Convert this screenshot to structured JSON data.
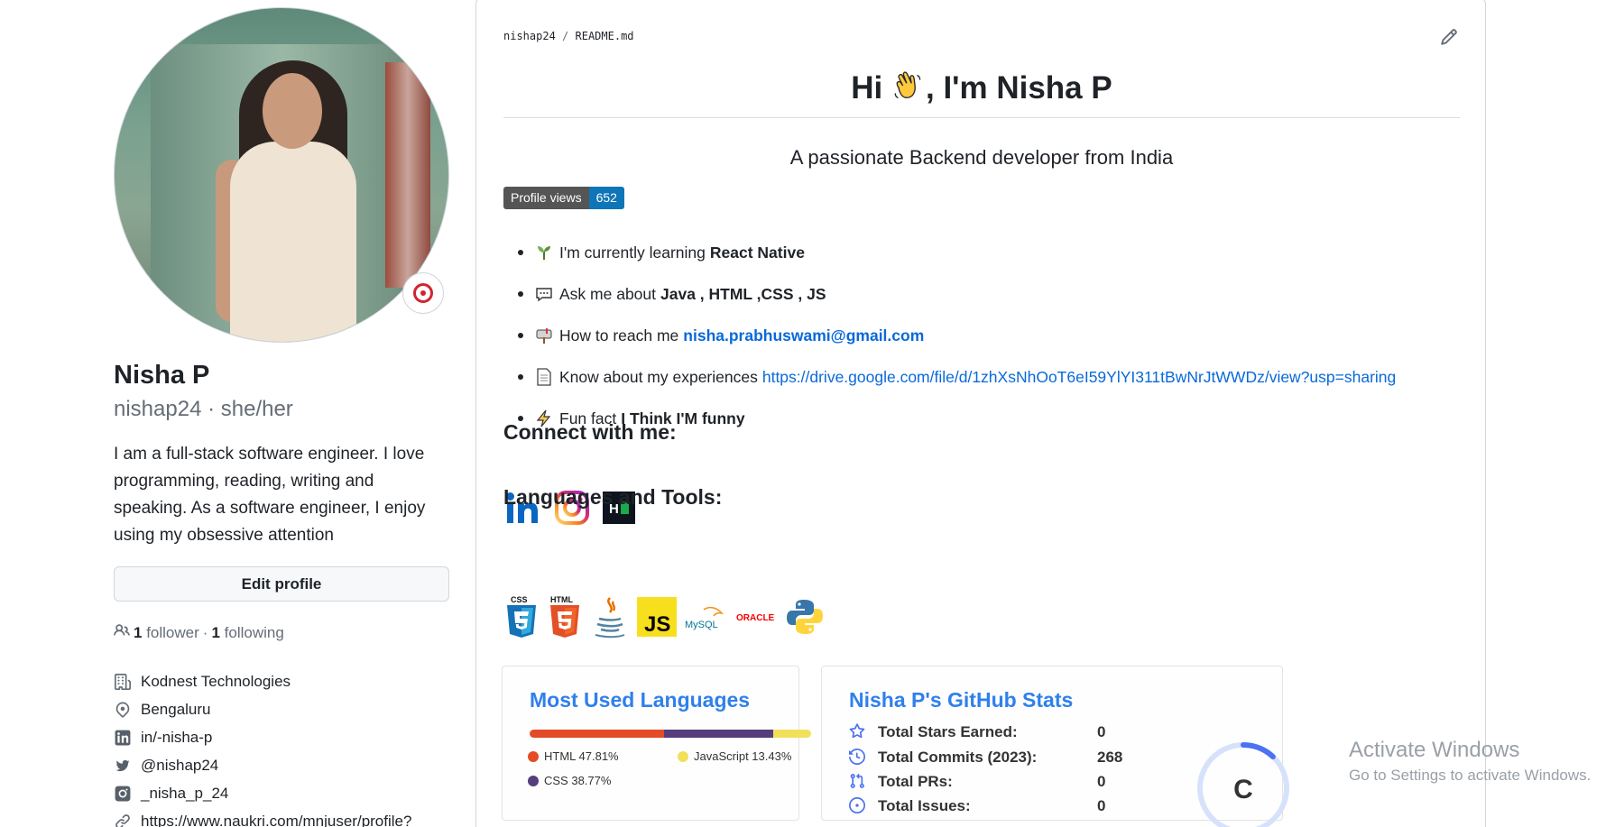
{
  "profile": {
    "name": "Nisha P",
    "login_line": "nishap24 · she/her",
    "bio": "I am a full-stack software engineer. I love programming, reading, writing and speaking. As a software engineer, I enjoy using my obsessive attention",
    "edit_button": "Edit profile",
    "followers_count": "1",
    "followers_label": "follower",
    "following_count": "1",
    "following_label": "following",
    "separator": "·",
    "details": [
      {
        "icon": "organization-icon",
        "text": "Kodnest Technologies"
      },
      {
        "icon": "location-icon",
        "text": "Bengaluru"
      },
      {
        "icon": "linkedin-icon",
        "text": "in/-nisha-p"
      },
      {
        "icon": "twitter-icon",
        "text": "@nishap24"
      },
      {
        "icon": "instagram-icon",
        "text": "_nisha_p_24"
      },
      {
        "icon": "link-icon",
        "text": "https://www.naukri.com/mnjuser/profile?"
      }
    ]
  },
  "readme": {
    "breadcrumb_user": "nishap24",
    "breadcrumb_sep": "/",
    "breadcrumb_file": "README.md",
    "heading_pre": "Hi",
    "heading_post": ", I'm Nisha P",
    "subheading": "A passionate Backend developer from India",
    "views_label": "Profile views",
    "views_count": "652",
    "bullets": {
      "learning_text": "I'm currently learning",
      "learning_bold": "React Native",
      "ask_text": "Ask me about",
      "ask_bold": "Java , HTML ,CSS , JS",
      "reach_text": "How to reach me",
      "reach_link": "nisha.prabhuswami@gmail.com",
      "exp_text": "Know about my experiences",
      "exp_link": "https://drive.google.com/file/d/1zhXsNhOoT6eI59YlYI311tBwNrJtWWDz/view?usp=sharing",
      "fun_text": "Fun fact",
      "fun_bold": "I Think I'M funny"
    },
    "connect_heading": "Connect with me:",
    "tools_heading": "Languages and Tools:",
    "tool_labels": {
      "css": "CSS",
      "html": "HTML",
      "js": "JS",
      "mysql": "MySQL",
      "oracle": "ORACLE",
      "hackerrank": "H"
    }
  },
  "languages_card": {
    "title": "Most Used Languages",
    "items": [
      {
        "name": "HTML",
        "percent": 47.81,
        "label": "HTML 47.81%",
        "color": "#e34c26"
      },
      {
        "name": "CSS",
        "percent": 38.77,
        "label": "CSS 38.77%",
        "color": "#563d7c"
      },
      {
        "name": "JavaScript",
        "percent": 13.43,
        "label": "JavaScript 13.43%",
        "color": "#f1e05a"
      }
    ]
  },
  "stats_card": {
    "title": "Nisha P's GitHub Stats",
    "rows": [
      {
        "icon": "star-icon",
        "label": "Total Stars Earned:",
        "value": "0"
      },
      {
        "icon": "history-icon",
        "label": "Total Commits (2023):",
        "value": "268"
      },
      {
        "icon": "pull-request-icon",
        "label": "Total PRs:",
        "value": "0"
      },
      {
        "icon": "issue-icon",
        "label": "Total Issues:",
        "value": "0"
      }
    ],
    "rank": "C",
    "rank_progress": 0.12
  },
  "watermark": {
    "line1": "Activate Windows",
    "line2": "Go to Settings to activate Windows."
  },
  "colors": {
    "accent_link": "#0969da",
    "stats_title": "#2f80ed",
    "views_badge": "#0e75b6"
  }
}
